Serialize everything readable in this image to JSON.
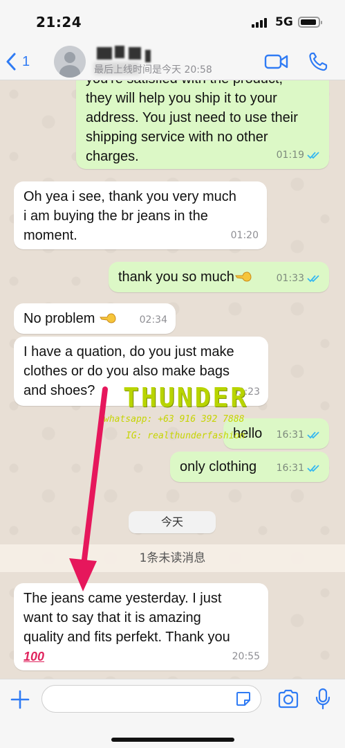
{
  "status_bar": {
    "time": "21:24",
    "network": "5G"
  },
  "header": {
    "back_count": "1",
    "status_text": "最后上线时间是今天 20:58"
  },
  "messages": [
    {
      "dir": "out",
      "text_lines": [
        "you're satisfied with the product,",
        "they will help you ship it to your",
        "address. You just need to use their",
        "shipping service with no other",
        "charges."
      ],
      "time": "01:19",
      "read": true
    },
    {
      "dir": "in",
      "text_lines": [
        "Oh yea i see, thank you very much",
        "i am buying the br jeans in the",
        "moment."
      ],
      "time": "01:20"
    },
    {
      "dir": "out",
      "text_lines": [
        "thank you so much"
      ],
      "emoji": "pointing-hand-emoji",
      "time": "01:33",
      "read": true
    },
    {
      "dir": "in",
      "text_lines": [
        "No problem"
      ],
      "emoji": "pointing-hand-emoji",
      "time": "02:34"
    },
    {
      "dir": "in",
      "text_lines": [
        "I have a quation, do you just make",
        "clothes or do you also make bags",
        "and shoes?"
      ],
      "time": "03:23"
    },
    {
      "dir": "out",
      "text_lines": [
        "hello"
      ],
      "time": "16:31",
      "read": true
    },
    {
      "dir": "out",
      "text_lines": [
        "only clothing"
      ],
      "time": "16:31",
      "read": true
    },
    {
      "dir": "in",
      "text_lines": [
        "The jeans came yesterday. I just",
        "want to say that it is amazing",
        "quality and fits perfekt. Thank you"
      ],
      "emoji": "hundred-points-emoji",
      "time": "20:55"
    }
  ],
  "date_separator": "今天",
  "unread_banner": "1条未读消息",
  "watermark": {
    "title": "THUNDER",
    "whatsapp": "whatsapp: +63 916 392 7888",
    "ig": "IG: realthunderfashion"
  },
  "input": {
    "value": "",
    "placeholder": ""
  },
  "colors": {
    "outgoing_bubble": "#dcf8c6",
    "incoming_bubble": "#ffffff",
    "accent": "#2f7bf4",
    "arrow": "#e6175c"
  }
}
